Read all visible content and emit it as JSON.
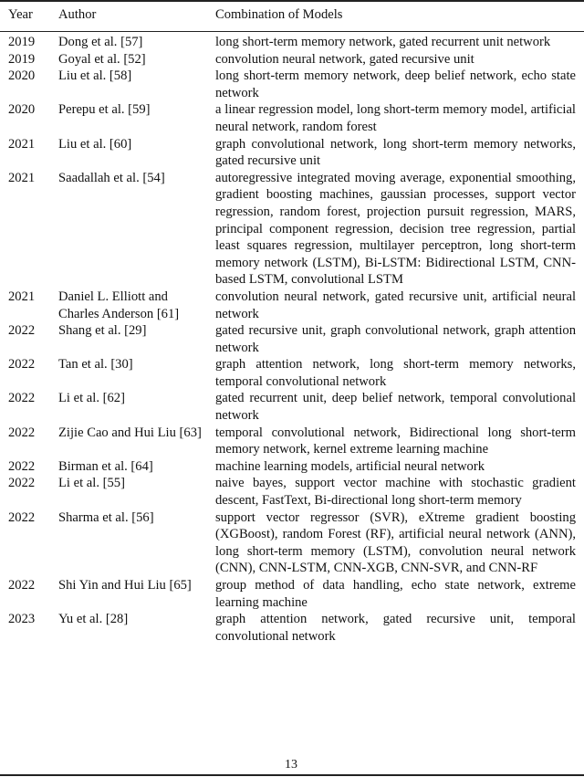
{
  "table": {
    "headers": [
      "Year",
      "Author",
      "Combination of Models"
    ],
    "rows": [
      {
        "year": "2019",
        "author": "Dong et al. [57]",
        "models": "long short-term memory network, gated recurrent unit network"
      },
      {
        "year": "2019",
        "author": "Goyal et al. [52]",
        "models": "convolution neural network, gated recursive unit"
      },
      {
        "year": "2020",
        "author": "Liu et al. [58]",
        "models": "long short-term memory network, deep belief network, echo state network"
      },
      {
        "year": "2020",
        "author": "Perepu et al. [59]",
        "models": "a linear regression model, long short-term memory model, artificial neural network, random forest"
      },
      {
        "year": "2021",
        "author": "Liu et al. [60]",
        "models": "graph convolutional network, long short-term memory networks, gated recursive unit"
      },
      {
        "year": "2021",
        "author": "Saadallah et al. [54]",
        "models": "autoregressive integrated moving average, exponential smoothing, gradient boosting machines, gaussian pro­cesses, support vector regression, random forest, projec­tion pursuit regression, MARS, principal component re­gression, decision tree regression, partial least squares re­gression, multilayer perceptron, long short-term memory network (LSTM), Bi-LSTM: Bidirectional LSTM, CNN-based LSTM, convolutional LSTM"
      },
      {
        "year": "2021",
        "author": "Daniel L. Elliott and Charles Anderson [61]",
        "models": "convolution neural network, gated recursive unit, artifi­cial neural network"
      },
      {
        "year": "2022",
        "author": "Shang et al. [29]",
        "models": "gated recursive unit, graph convolutional network, graph attention network"
      },
      {
        "year": "2022",
        "author": "Tan et al. [30]",
        "models": "graph attention network, long short-term memory net­works, temporal convolutional network"
      },
      {
        "year": "2022",
        "author": "Li et al. [62]",
        "models": "gated recurrent unit, deep belief network, temporal con­volutional network"
      },
      {
        "year": "2022",
        "author": "Zijie Cao and Hui Liu [63]",
        "models": "temporal convolutional network, Bidirectional long short-term memory network, kernel extreme learning ma­chine"
      },
      {
        "year": "2022",
        "author": "Birman et al. [64]",
        "models": "machine learning models, artificial neural network"
      },
      {
        "year": "2022",
        "author": "Li et al. [55]",
        "models": "naive bayes, support vector machine with stochastic gra­dient descent, FastText, Bi-directional long short-term memory"
      },
      {
        "year": "2022",
        "author": "Sharma et al. [56]",
        "models": "support vector regressor (SVR), eXtreme gradient boost­ing (XGBoost), random Forest (RF), artificial neural net­work (ANN), long short-term memory (LSTM), convo­lution neural network (CNN), CNN-LSTM, CNN-XGB, CNN-SVR, and CNN-RF"
      },
      {
        "year": "2022",
        "author": "Shi Yin and Hui Liu [65]",
        "models": "group method of data handling, echo state network, ex­treme learning machine"
      },
      {
        "year": "2023",
        "author": "Yu et al. [28]",
        "models": "graph attention network, gated recursive unit, temporal convolutional network"
      }
    ]
  },
  "page_number": "13"
}
